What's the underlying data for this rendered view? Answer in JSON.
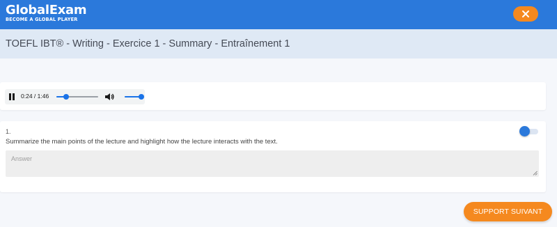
{
  "header": {
    "logo_text": "GlobalExam",
    "tagline": "BECOME A GLOBAL PLAYER",
    "close_icon": "close-icon"
  },
  "title_bar": {
    "title": "TOEFL IBT® - Writing - Exercice 1 - Summary - Entraînement 1"
  },
  "audio_player": {
    "state_icon": "pause-icon",
    "time": "0:24 / 1:46",
    "progress_fraction": 0.23,
    "volume_icon": "volume-icon",
    "volume_fraction": 1.0
  },
  "question": {
    "number": "1.",
    "prompt": "Summarize the main points of the lecture and highlight how the lecture interacts with the text.",
    "toggle_on": true,
    "answer_placeholder": "Answer",
    "answer_value": ""
  },
  "footer": {
    "next_label": "SUPPORT SUIVANT"
  },
  "colors": {
    "header_blue": "#2b79db",
    "title_bar_bg": "#dfe9f5",
    "accent_orange": "#f5891f",
    "page_bg": "#f5f7fb",
    "player_blue": "#1a73e8"
  }
}
